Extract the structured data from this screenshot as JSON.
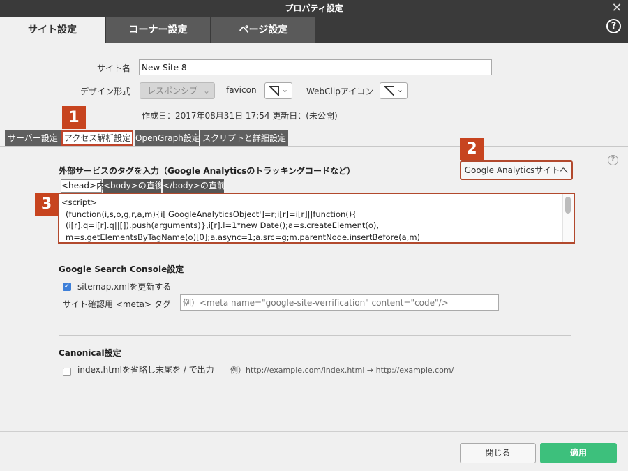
{
  "window": {
    "title": "プロパティ設定"
  },
  "main_tabs": [
    {
      "label": "サイト設定"
    },
    {
      "label": "コーナー設定"
    },
    {
      "label": "ページ設定"
    }
  ],
  "site": {
    "name_label": "サイト名",
    "name_value": "New Site 8",
    "design_label": "デザイン形式",
    "design_value": "レスポンシブ",
    "favicon_label": "favicon",
    "webclip_label": "WebClipアイコン",
    "dates": "作成日：2017年08月31日 17:54 更新日：(未公開)"
  },
  "sub_tabs": [
    {
      "label": "サーバー設定"
    },
    {
      "label": "アクセス解析設定"
    },
    {
      "label": "OpenGraph設定"
    },
    {
      "label": "スクリプトと詳細設定"
    }
  ],
  "badges": [
    "1",
    "2",
    "3"
  ],
  "analytics": {
    "heading": "外部サービスのタグを入力（Google Analyticsのトラッキングコードなど）",
    "ga_button": "Google Analyticsサイトへ",
    "code_tabs": [
      {
        "label": "<head>内"
      },
      {
        "label": "<body>の直後"
      },
      {
        "label": "</body>の直前"
      }
    ],
    "code_lines": [
      "<script>",
      "(function(i,s,o,g,r,a,m){i['GoogleAnalyticsObject']=r;i[r]=i[r]||function(){",
      "(i[r].q=i[r].q||[]).push(arguments)},i[r].l=1*new Date();a=s.createElement(o),",
      "m=s.getElementsByTagName(o)[0];a.async=1;a.src=g;m.parentNode.insertBefore(a,m)"
    ]
  },
  "search_console": {
    "heading": "Google Search Console設定",
    "sitemap_label": "sitemap.xmlを更新する",
    "sitemap_checked": true,
    "meta_label": "サイト確認用 <meta> タグ",
    "meta_placeholder": "例）<meta name=\"google-site-verrification\" content=\"code\"/>"
  },
  "canonical": {
    "heading": "Canonical設定",
    "option_label": "index.htmlを省略し末尾を / で出力",
    "example": "例）http://example.com/index.html → http://example.com/"
  },
  "footer": {
    "close_label": "閉じる",
    "apply_label": "適用"
  },
  "colors": {
    "accent_red": "#c7441f",
    "apply_green": "#3dc07c",
    "checkbox_blue": "#3d7fd9"
  }
}
